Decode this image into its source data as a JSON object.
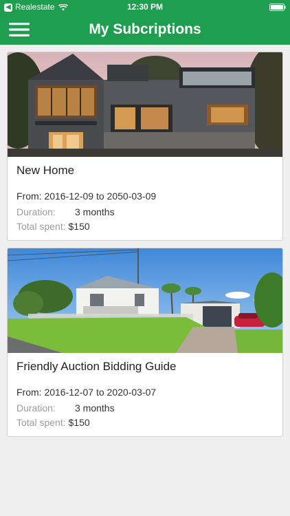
{
  "status_bar": {
    "back_app": "Realestate",
    "time": "12:30 PM"
  },
  "nav": {
    "title": "My Subcriptions"
  },
  "subscriptions": [
    {
      "title": "New Home",
      "date_from_label": "From:",
      "date_from": "2016-12-09",
      "date_to_label": "to",
      "date_to": "2050-03-09",
      "duration_label": "Duration:",
      "duration": "3 months",
      "spent_label": "Total spent:",
      "spent": "$150"
    },
    {
      "title": "Friendly Auction Bidding Guide",
      "date_from_label": "From:",
      "date_from": "2016-12-07",
      "date_to_label": "to",
      "date_to": "2020-03-07",
      "duration_label": "Duration:",
      "duration": "3 months",
      "spent_label": "Total spent:",
      "spent": "$150"
    }
  ],
  "colors": {
    "brand_green": "#1e9e4e",
    "label_gray": "#9b9b9b"
  },
  "icons": {
    "menu": "menu-icon",
    "wifi": "wifi-icon",
    "battery": "battery-icon"
  }
}
